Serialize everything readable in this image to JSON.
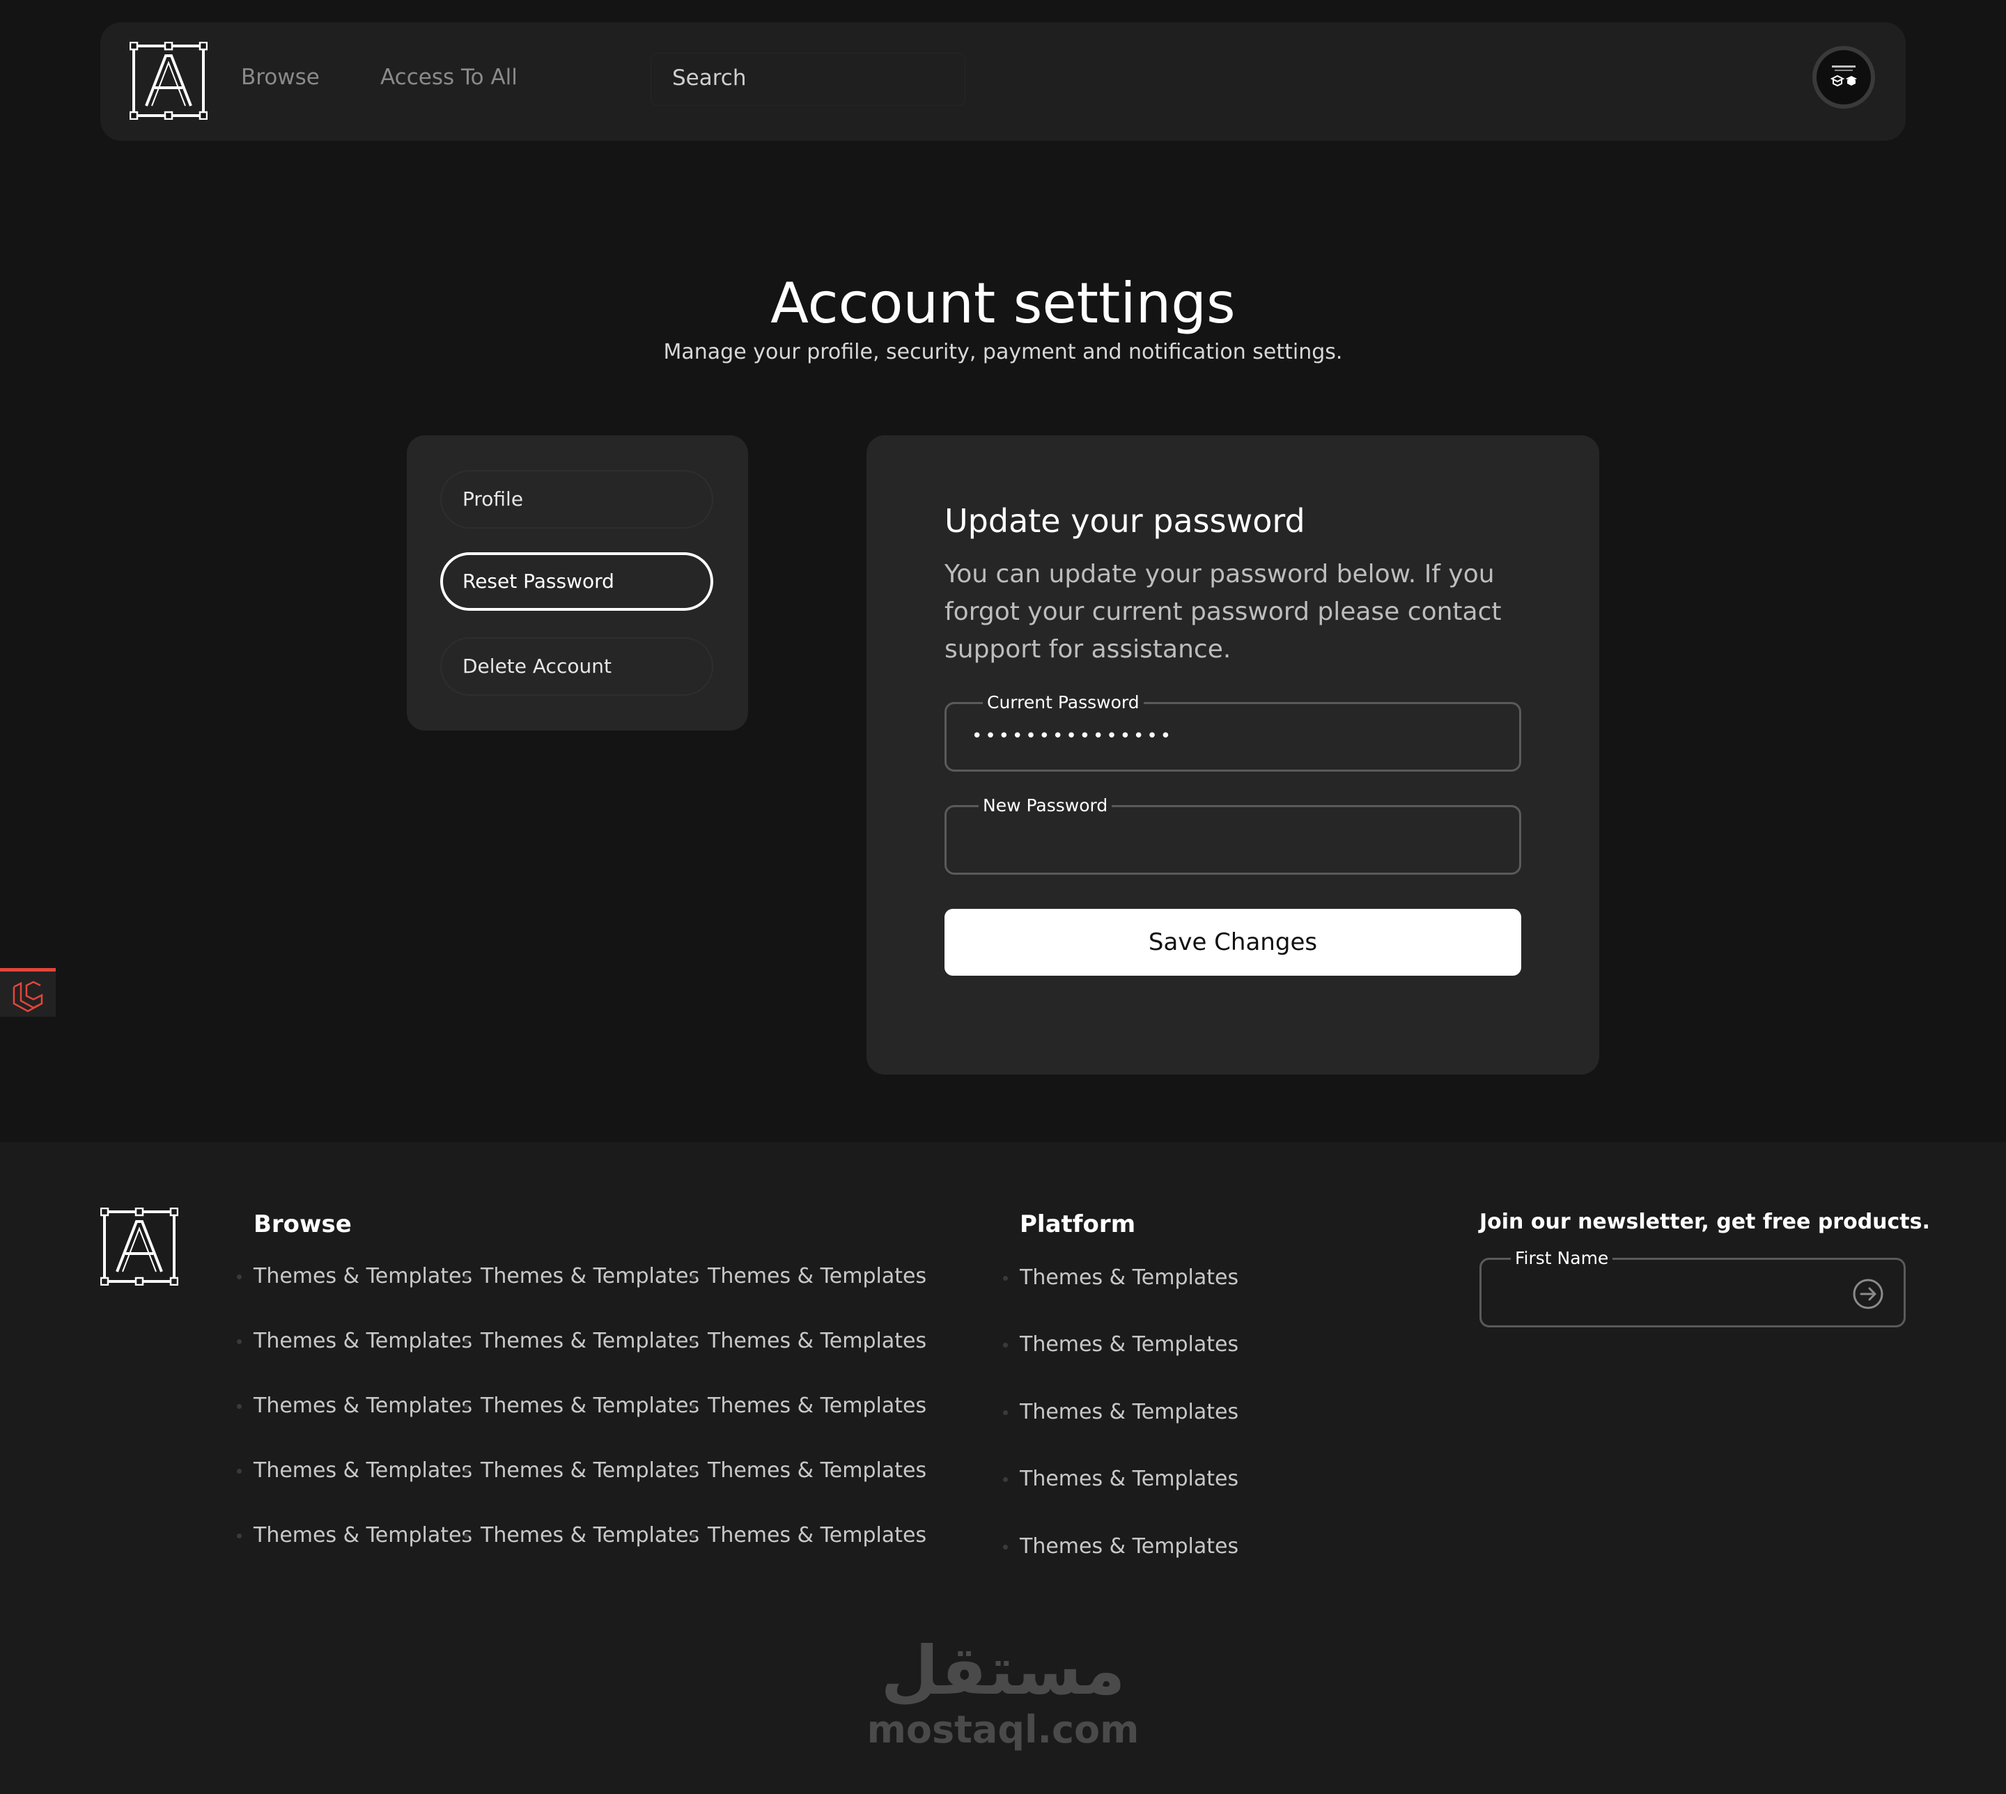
{
  "header": {
    "logo_name": "A",
    "nav": [
      "Browse",
      "Access To All"
    ],
    "search_label": "Search"
  },
  "page": {
    "title": "Account settings",
    "subtitle": "Manage your profile, security, payment and notification settings."
  },
  "side_menu": {
    "items": [
      {
        "label": "Profile",
        "active": false
      },
      {
        "label": "Reset Password",
        "active": true
      },
      {
        "label": "Delete Account",
        "active": false
      }
    ]
  },
  "password_form": {
    "title": "Update your password",
    "description": "You can update your password below. If you forgot your current password please contact support for assistance.",
    "current_label": "Current Password",
    "current_value": "•••••••••••••••",
    "new_label": "New Password",
    "new_value": "",
    "save_label": "Save Changes"
  },
  "footer": {
    "browse": {
      "heading": "Browse",
      "links": [
        "Themes & Templates",
        "Themes & Templates",
        "Themes & Templates",
        "Themes & Templates",
        "Themes & Templates",
        "Themes & Templates",
        "Themes & Templates",
        "Themes & Templates",
        "Themes & Templates",
        "Themes & Templates",
        "Themes & Templates",
        "Themes & Templates",
        "Themes & Templates",
        "Themes & Templates",
        "Themes & Templates"
      ]
    },
    "platform": {
      "heading": "Platform",
      "links": [
        "Themes & Templates",
        "Themes & Templates",
        "Themes & Templates",
        "Themes & Templates",
        "Themes & Templates"
      ]
    },
    "newsletter": {
      "title": "Join our newsletter, get free products.",
      "field_label": "First Name",
      "field_value": ""
    }
  },
  "watermark": {
    "arabic": "مستقل",
    "text": "mostaql.com"
  },
  "colors": {
    "background": "#141414",
    "card": "#262626",
    "accent_badge": "#e2463b",
    "button": "#ffffff"
  },
  "icons": {
    "logo": "a-logo-frame-icon",
    "avatar": "user-avatar-icon",
    "arrow": "arrow-right-circle-icon",
    "badge": "laravel-icon"
  }
}
